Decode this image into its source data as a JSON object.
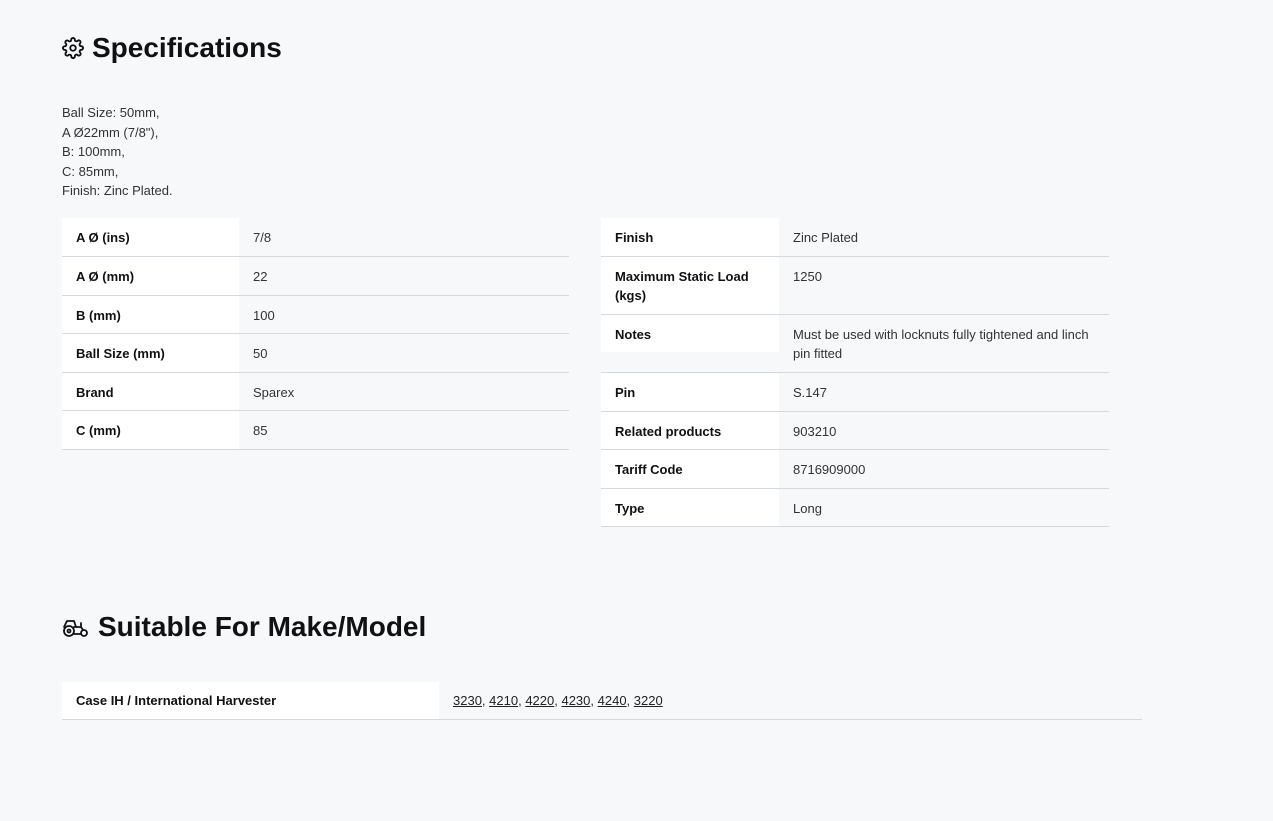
{
  "specifications": {
    "title": "Specifications",
    "icon": "gear-icon",
    "description": [
      "Ball Size: 50mm,",
      "A Ø22mm (7/8\"),",
      "B: 100mm,",
      "C: 85mm,",
      "Finish: Zinc Plated."
    ],
    "left_rows": [
      {
        "key": "A Ø (ins)",
        "value": "7/8"
      },
      {
        "key": "A Ø (mm)",
        "value": "22"
      },
      {
        "key": "B (mm)",
        "value": "100"
      },
      {
        "key": "Ball Size (mm)",
        "value": "50"
      },
      {
        "key": "Brand",
        "value": "Sparex"
      },
      {
        "key": "C (mm)",
        "value": "85"
      }
    ],
    "right_rows": [
      {
        "key": "Finish",
        "value": "Zinc Plated"
      },
      {
        "key": "Maximum Static Load (kgs)",
        "value": "1250"
      },
      {
        "key": "Notes",
        "value": "Must be used with locknuts fully tightened and linch pin fitted"
      },
      {
        "key": "Pin",
        "value": "S.147"
      },
      {
        "key": "Related products",
        "value": "903210"
      },
      {
        "key": "Tariff Code",
        "value": "8716909000"
      },
      {
        "key": "Type",
        "value": "Long"
      }
    ]
  },
  "suitable": {
    "title": "Suitable For Make/Model",
    "icon": "tractor-icon",
    "rows": [
      {
        "make": "Case IH / International Harvester",
        "models": [
          "3230",
          "4210",
          "4220",
          "4230",
          "4240",
          "3220"
        ]
      }
    ]
  }
}
